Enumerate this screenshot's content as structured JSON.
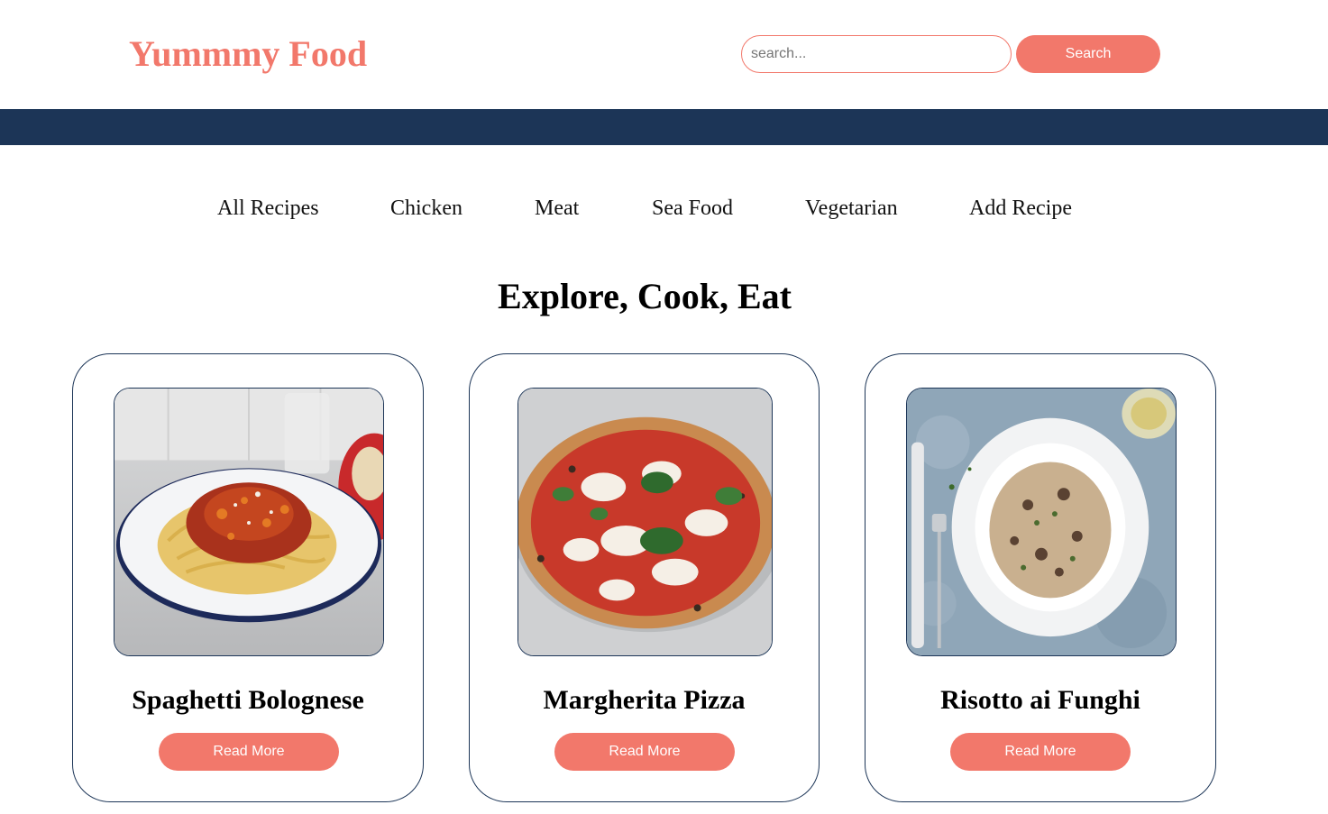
{
  "header": {
    "logo": "Yummmy Food",
    "search_placeholder": "search...",
    "search_label": "Search"
  },
  "nav": {
    "items": [
      "All Recipes",
      "Chicken",
      "Meat",
      "Sea Food",
      "Vegetarian",
      "Add Recipe"
    ]
  },
  "main": {
    "title": "Explore, Cook, Eat"
  },
  "cards": [
    {
      "title": "Spaghetti Bolognese",
      "button_label": "Read More",
      "image": "spaghetti-bolognese-photo"
    },
    {
      "title": "Margherita Pizza",
      "button_label": "Read More",
      "image": "margherita-pizza-photo"
    },
    {
      "title": "Risotto ai Funghi",
      "button_label": "Read More",
      "image": "risotto-ai-funghi-photo"
    }
  ],
  "colors": {
    "accent": "#f2786b",
    "navy": "#1c3557"
  }
}
